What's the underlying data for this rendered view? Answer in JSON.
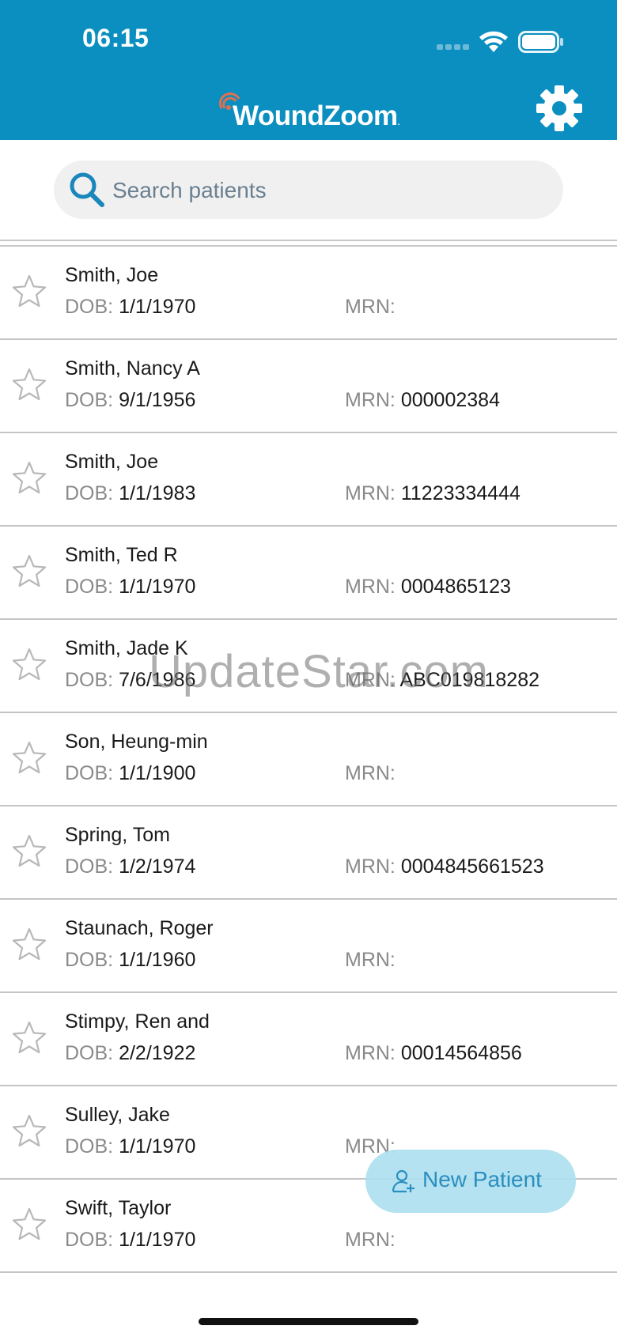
{
  "status_bar": {
    "time": "06:15"
  },
  "header": {
    "logo_text": "WoundZoom",
    "logo_suffix": "."
  },
  "search": {
    "placeholder": "Search patients",
    "value": ""
  },
  "labels": {
    "dob": "DOB:",
    "mrn": "MRN:"
  },
  "patients": [
    {
      "name": "Smith, Joe",
      "dob": "1/1/1970",
      "mrn": ""
    },
    {
      "name": "Smith, Nancy A",
      "dob": "9/1/1956",
      "mrn": "000002384"
    },
    {
      "name": "Smith, Joe",
      "dob": "1/1/1983",
      "mrn": "11223334444"
    },
    {
      "name": "Smith, Ted R",
      "dob": "1/1/1970",
      "mrn": "0004865123"
    },
    {
      "name": "Smith, Jade K",
      "dob": "7/6/1986",
      "mrn": "ABC019818282"
    },
    {
      "name": "Son, Heung-min",
      "dob": "1/1/1900",
      "mrn": ""
    },
    {
      "name": "Spring, Tom",
      "dob": "1/2/1974",
      "mrn": "0004845661523"
    },
    {
      "name": "Staunach, Roger",
      "dob": "1/1/1960",
      "mrn": ""
    },
    {
      "name": "Stimpy, Ren and",
      "dob": "2/2/1922",
      "mrn": "00014564856"
    },
    {
      "name": "Sulley, Jake",
      "dob": "1/1/1970",
      "mrn": ""
    },
    {
      "name": "Swift, Taylor",
      "dob": "1/1/1970",
      "mrn": ""
    }
  ],
  "fab": {
    "label": "New Patient"
  },
  "watermark": "UpdateStar.com",
  "colors": {
    "header": "#0a8fc0",
    "accent": "#1a86bc",
    "fab_bg": "#aee0ef"
  },
  "icons": {
    "signal": "cellular-signal-icon",
    "wifi": "wifi-icon",
    "battery": "battery-icon",
    "settings": "gear-icon",
    "search": "search-icon",
    "favorite": "star-outline-icon",
    "new_patient": "add-user-icon"
  }
}
